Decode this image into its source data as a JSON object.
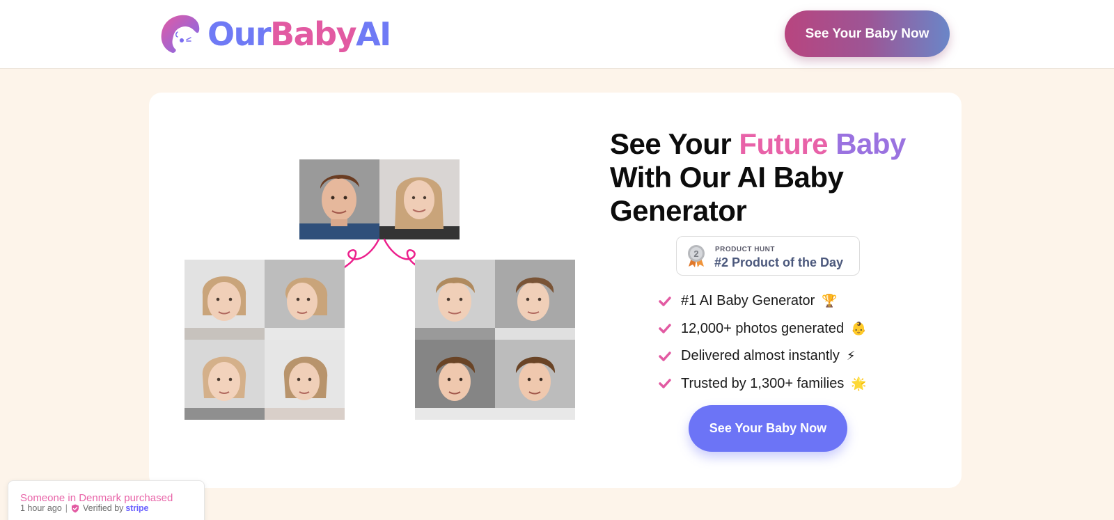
{
  "header": {
    "logo": {
      "part1": "Our",
      "part2": "Baby",
      "part3": "AI"
    },
    "cta_label": "See Your Baby Now"
  },
  "hero": {
    "headline": {
      "part1": "See Your ",
      "highlight1": "Future",
      "highlight2": "Baby",
      "part2": "With Our AI Baby Generator"
    },
    "badge": {
      "small": "PRODUCT HUNT",
      "big": "#2 Product of the Day",
      "rank": "2"
    },
    "features": [
      {
        "text": "#1 AI Baby Generator",
        "emoji": "🏆"
      },
      {
        "text": "12,000+ photos generated",
        "emoji": "👶"
      },
      {
        "text": "Delivered almost instantly",
        "emoji": "⚡"
      },
      {
        "text": "Trusted by 1,300+ families",
        "emoji": "🌟"
      }
    ],
    "cta_label": "See Your Baby Now"
  },
  "toast": {
    "title": "Someone in Denmark purchased",
    "time": "1 hour ago",
    "verified": "Verified by",
    "brand": "stripe"
  },
  "colors": {
    "accent_pink": "#e862a8",
    "accent_purple": "#9a72e0",
    "accent_blue": "#6c74f6",
    "background": "#fdf4ea"
  }
}
